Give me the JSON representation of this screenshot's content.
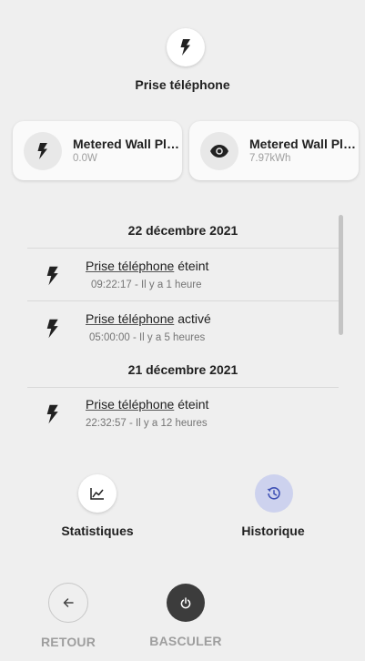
{
  "header": {
    "title": "Prise téléphone",
    "icon": "flash-icon"
  },
  "cards": [
    {
      "name": "Metered Wall Plug Switch: Electric Consumption (Watts)",
      "value": "0.0W",
      "icon": "flash-icon"
    },
    {
      "name": "Metered Wall Plug Switch: Electric Consumption (kWh)",
      "value": "7.97kWh",
      "icon": "eye-icon"
    }
  ],
  "history": {
    "groups": [
      {
        "date": "22 décembre 2021",
        "entries": [
          {
            "entity": "Prise téléphone",
            "state": "éteint",
            "time": "09:22:17 - Il y a 1 heure"
          },
          {
            "entity": "Prise téléphone",
            "state": "activé",
            "time": "05:00:00 - Il y a 5 heures"
          }
        ]
      },
      {
        "date": "21 décembre 2021",
        "entries": [
          {
            "entity": "Prise téléphone",
            "state": "éteint",
            "time": "22:32:57 - Il y a 12 heures"
          }
        ]
      }
    ]
  },
  "actions": {
    "statistics": "Statistiques",
    "history": "Historique"
  },
  "controls": {
    "back": "RETOUR",
    "toggle": "BASCULER"
  },
  "colors": {
    "accent": "#3f51b5",
    "history_active_bg": "#cdd2ee",
    "toggle_bg": "#3c3c3c"
  }
}
